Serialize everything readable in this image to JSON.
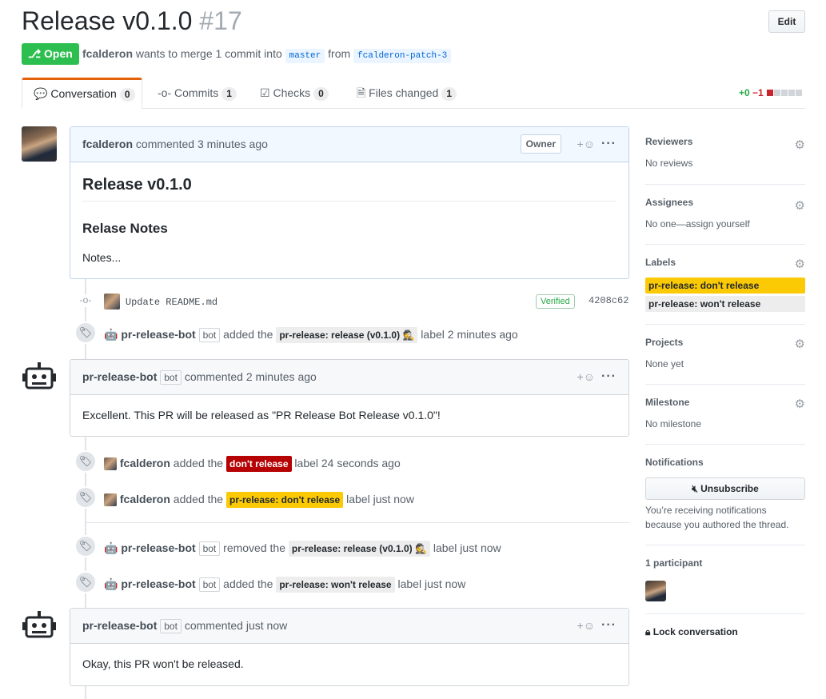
{
  "header": {
    "title": "Release v0.1.0",
    "number": "#17",
    "edit_label": "Edit",
    "state_label": "Open",
    "author": "fcalderon",
    "merge_text": "wants to merge 1 commit into",
    "base_branch": "master",
    "from_text": "from",
    "head_branch": "fcalderon-patch-3"
  },
  "tabs": [
    {
      "label": "Conversation",
      "count": "0"
    },
    {
      "label": "Commits",
      "count": "1"
    },
    {
      "label": "Checks",
      "count": "0"
    },
    {
      "label": "Files changed",
      "count": "1"
    }
  ],
  "diffstat": {
    "additions": "+0",
    "deletions": "−1"
  },
  "timeline": {
    "comment1": {
      "author": "fcalderon",
      "action": "commented 3 minutes ago",
      "badge": "Owner",
      "h2": "Release v0.1.0",
      "h3": "Relase Notes",
      "body": "Notes..."
    },
    "commit": {
      "message": "Update README.md",
      "verified": "Verified",
      "sha": "4208c62"
    },
    "event1": {
      "actor": "pr-release-bot",
      "bot": "bot",
      "verb": "added the",
      "label": "pr-release: release (v0.1.0)",
      "suffix": "label 2 minutes ago"
    },
    "comment2": {
      "author": "pr-release-bot",
      "bot": "bot",
      "action": "commented 2 minutes ago",
      "body": "Excellent. This PR will be released as \"PR Release Bot Release v0.1.0\"!"
    },
    "event2": {
      "actor": "fcalderon",
      "verb": "added the",
      "label": "don't release",
      "suffix": "label 24 seconds ago"
    },
    "event3": {
      "actor": "fcalderon",
      "verb": "added the",
      "label": "pr-release: don't release",
      "suffix": "label just now"
    },
    "event4": {
      "actor": "pr-release-bot",
      "bot": "bot",
      "verb": "removed the",
      "label": "pr-release: release (v0.1.0)",
      "suffix": "label just now"
    },
    "event5": {
      "actor": "pr-release-bot",
      "bot": "bot",
      "verb": "added the",
      "label": "pr-release: won't release",
      "suffix": "label just now"
    },
    "comment3": {
      "author": "pr-release-bot",
      "bot": "bot",
      "action": "commented just now",
      "body": "Okay, this PR won't be released."
    },
    "reaction_plus": "+"
  },
  "sidebar": {
    "reviewers": {
      "title": "Reviewers",
      "value": "No reviews"
    },
    "assignees": {
      "title": "Assignees",
      "value": "No one—assign yourself"
    },
    "labels": {
      "title": "Labels",
      "items": [
        "pr-release: don't release",
        "pr-release: won't release"
      ]
    },
    "projects": {
      "title": "Projects",
      "value": "None yet"
    },
    "milestone": {
      "title": "Milestone",
      "value": "No milestone"
    },
    "notifications": {
      "title": "Notifications",
      "button": "Unsubscribe",
      "note_line1": "You’re receiving notifications",
      "note_line2": "because you authored the thread."
    },
    "participants": {
      "title": "1 participant"
    },
    "lock": "Lock conversation"
  },
  "colors": {
    "open": "#2cbe4e",
    "label_red": "#b60205",
    "label_yellow": "#fbca04",
    "label_gray": "#ededed",
    "active_tab": "#e36209"
  }
}
